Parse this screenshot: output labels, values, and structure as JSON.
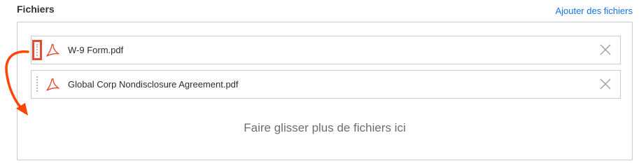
{
  "section": {
    "title": "Fichiers",
    "add_files_label": "Ajouter des fichiers"
  },
  "files": [
    {
      "name": "W-9 Form.pdf",
      "icon": "pdf-icon"
    },
    {
      "name": "Global Corp Nondisclosure Agreement.pdf",
      "icon": "pdf-icon"
    }
  ],
  "dropzone": {
    "label": "Faire glisser plus de fichiers ici"
  },
  "colors": {
    "accent_link": "#1473e6",
    "pdf_red": "#e34c32",
    "annotation_red": "#ff4500",
    "border": "#cacaca"
  }
}
